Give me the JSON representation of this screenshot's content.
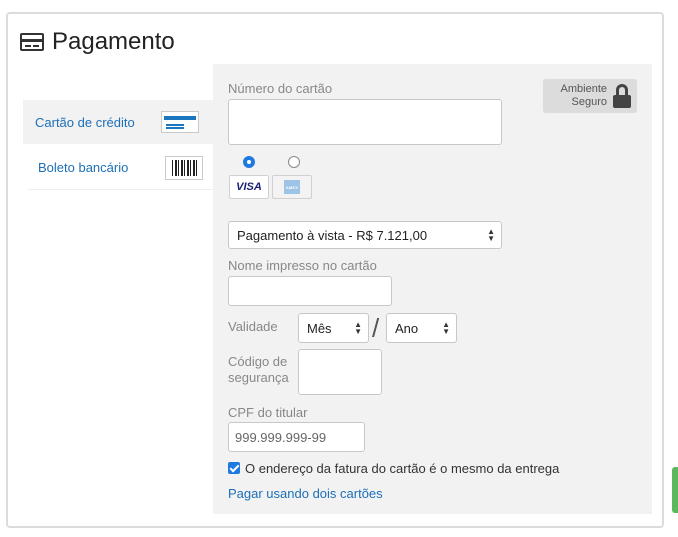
{
  "panel": {
    "title": "Pagamento"
  },
  "methods": [
    {
      "label": "Cartão de crédito",
      "active": true
    },
    {
      "label": "Boleto bancário",
      "active": false
    }
  ],
  "form": {
    "card_number_label": "Número do cartão",
    "card_number_value": "",
    "secure_badge": {
      "line1": "Ambiente",
      "line2": "Seguro"
    },
    "brands": [
      {
        "name": "VISA",
        "selected": true
      },
      {
        "name": "AMEX",
        "selected": false
      }
    ],
    "installments_selected": "Pagamento à vista - R$ 7.121,00",
    "name_label": "Nome impresso no cartão",
    "name_value": "",
    "validity_label": "Validade",
    "month_selected": "Mês",
    "year_selected": "Ano",
    "separator": "/",
    "security_code_label_line1": "Código de",
    "security_code_label_line2": "segurança",
    "security_code_value": "",
    "cpf_label": "CPF do titular",
    "cpf_placeholder": "999.999.999-99",
    "same_address_checked": true,
    "same_address_label": "O endereço da fatura do cartão é o mesmo da entrega",
    "two_cards_link": "Pagar usando dois cartões"
  },
  "colors": {
    "accent": "#1f7ae0",
    "link": "#1d6fb7",
    "form_bg": "#f2f2f2",
    "green_edge": "#5cb85c"
  }
}
